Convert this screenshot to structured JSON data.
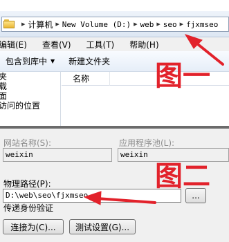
{
  "address_bar": {
    "crumbs": [
      "计算机",
      "New Volume (D:)",
      "web",
      "seo",
      "fjxmseo"
    ]
  },
  "menu": {
    "items": [
      "编辑(E)",
      "查看(V)",
      "工具(T)",
      "帮助(H)"
    ]
  },
  "toolbar": {
    "include_label": "包含到库中",
    "new_folder_label": "新建文件夹"
  },
  "nav_pane": {
    "items": [
      "夹",
      "载",
      "面",
      "访问的位置"
    ]
  },
  "file_pane": {
    "column_name": "名称"
  },
  "dialog": {
    "site_name_label": "网站名称(S):",
    "site_name_value": "weixin",
    "app_pool_label": "应用程序池(L):",
    "app_pool_value": "weixin",
    "physical_path_label": "物理路径(P):",
    "physical_path_value": "D:\\web\\seo\\fjxmseo",
    "browse_label": "...",
    "pass_auth_label": "传递身份验证",
    "connect_as_label": "连接为(C)...",
    "test_settings_label": "测试设置(G)..."
  },
  "annotations": {
    "label_one": "图一",
    "label_two": "图二",
    "color": "#e2222b"
  }
}
